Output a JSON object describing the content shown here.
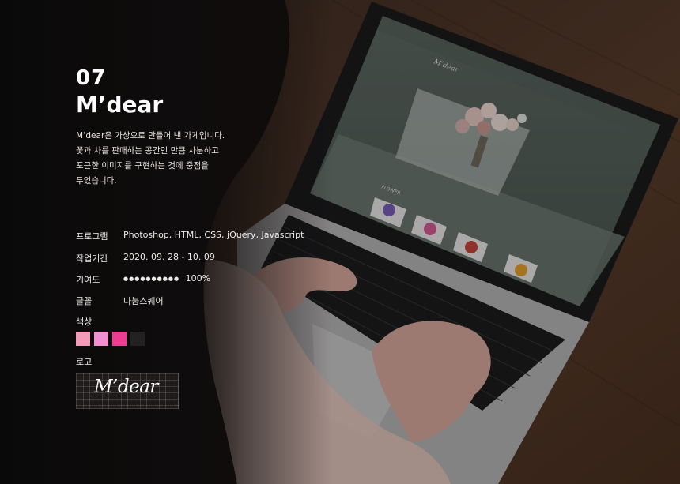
{
  "project": {
    "number": "07",
    "title": "M’dear",
    "description_lines": [
      "M’dear은 가상으로 만들어 낸 가게입니다.",
      "꽃과 차를 판매하는 공간인 만큼 차분하고",
      "포근한 이미지를 구현하는 것에 중점을",
      "두었습니다."
    ]
  },
  "details": {
    "program": {
      "label": "프로그램",
      "value": "Photoshop, HTML, CSS, jQuery, Javascript"
    },
    "period": {
      "label": "작업기간",
      "value": "2020. 09. 28 - 10. 09"
    },
    "contribution": {
      "label": "기여도",
      "dots": "●●●●●●●●●●",
      "value": "100%",
      "percent": 100
    },
    "font": {
      "label": "글꼴",
      "value": "나눔스퀘어"
    }
  },
  "colors": {
    "label": "색상",
    "swatches": [
      "#f29bb8",
      "#f08fd2",
      "#ee3c93",
      "#222222"
    ]
  },
  "logo": {
    "label": "로고",
    "text": "M’dear"
  },
  "photo": {
    "screen_logo": "M’dear",
    "screen_section": "FLOWER"
  }
}
